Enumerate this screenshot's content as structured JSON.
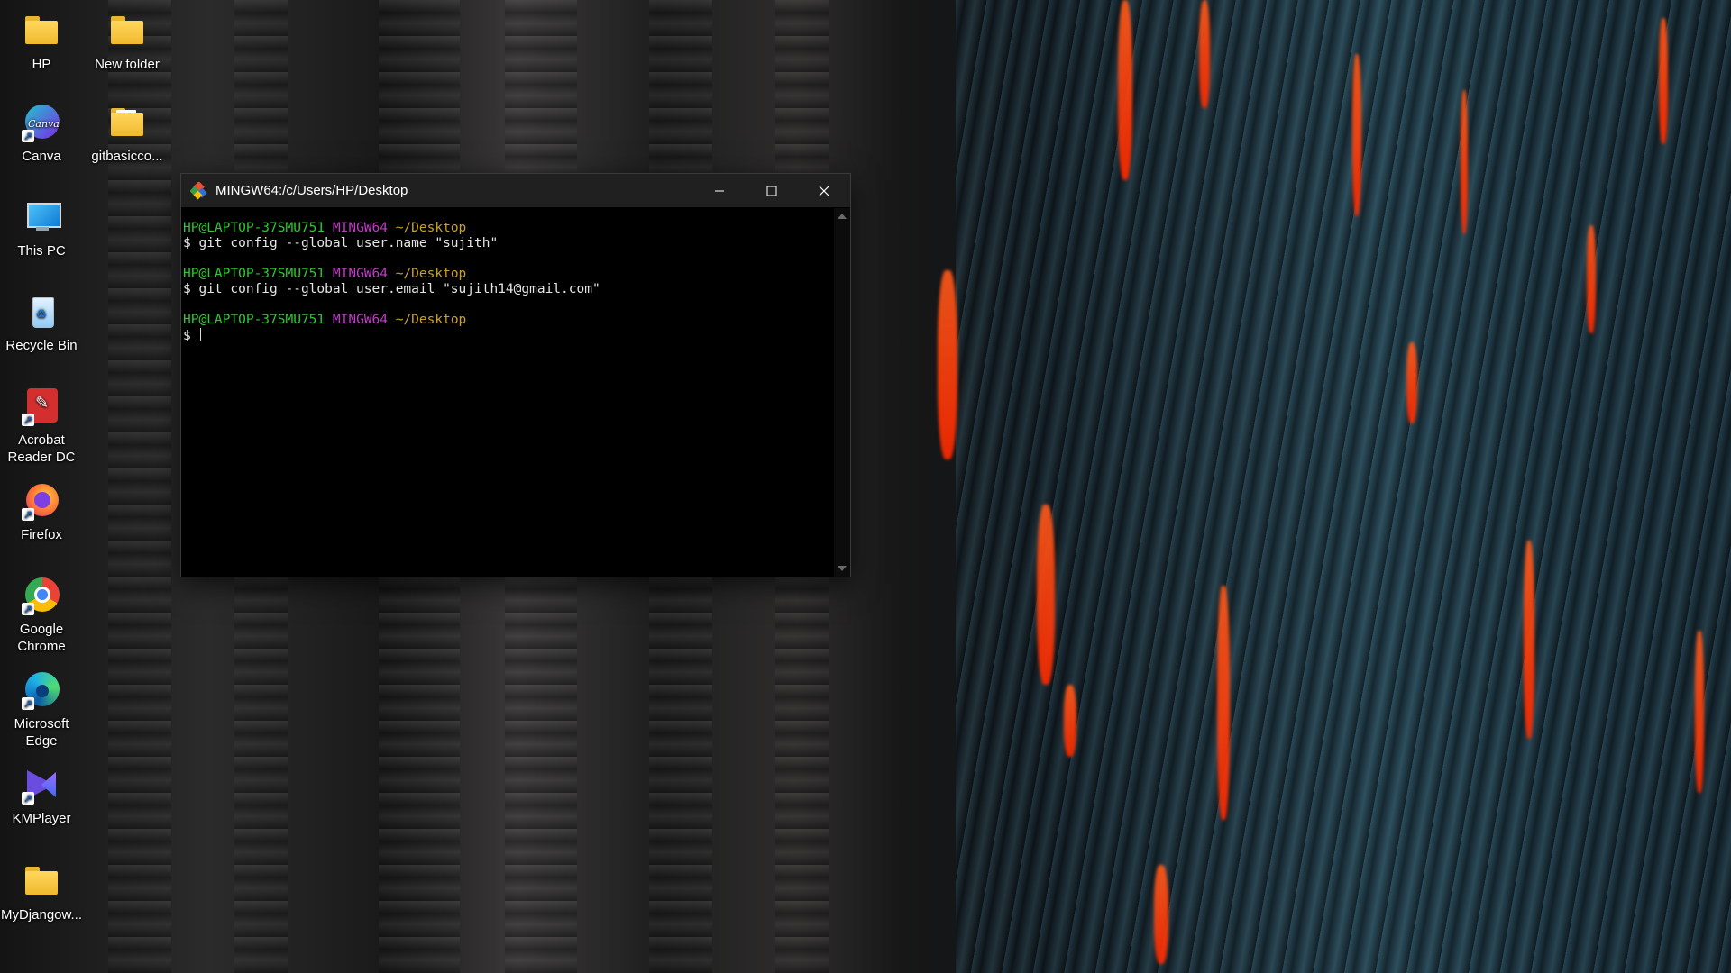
{
  "desktop": {
    "icons": [
      {
        "label": "HP",
        "icon": "folder-icon"
      },
      {
        "label": "New folder",
        "icon": "folder-icon"
      },
      {
        "label": "Canva",
        "icon": "canva-icon"
      },
      {
        "label": "gitbasicco...",
        "icon": "folder-icon"
      },
      {
        "label": "This PC",
        "icon": "monitor-icon"
      },
      {
        "label": "Recycle Bin",
        "icon": "recycle-bin-icon"
      },
      {
        "label": "Acrobat Reader DC",
        "icon": "acrobat-icon"
      },
      {
        "label": "Firefox",
        "icon": "firefox-icon"
      },
      {
        "label": "Google Chrome",
        "icon": "chrome-icon"
      },
      {
        "label": "Microsoft Edge",
        "icon": "edge-icon"
      },
      {
        "label": "KMPlayer",
        "icon": "kmplayer-icon"
      },
      {
        "label": "MyDjangow...",
        "icon": "folder-icon"
      }
    ]
  },
  "terminal": {
    "title": "MINGW64:/c/Users/HP/Desktop",
    "buttons": {
      "minimize": "—",
      "maximize": "☐",
      "close": "✕"
    },
    "prompt_user": "HP@LAPTOP-37SMU751",
    "prompt_env": "MINGW64",
    "prompt_dir": "~/Desktop",
    "commands": [
      "$ git config --global user.name \"sujith\"",
      "$ git config --global user.email \"sujith14@gmail.com\""
    ],
    "current_prompt": "$ ",
    "colors": {
      "user": "#2ec92e",
      "env": "#c23ac9",
      "dir": "#c9a326",
      "background": "#000000",
      "titlebar": "#202020"
    }
  }
}
